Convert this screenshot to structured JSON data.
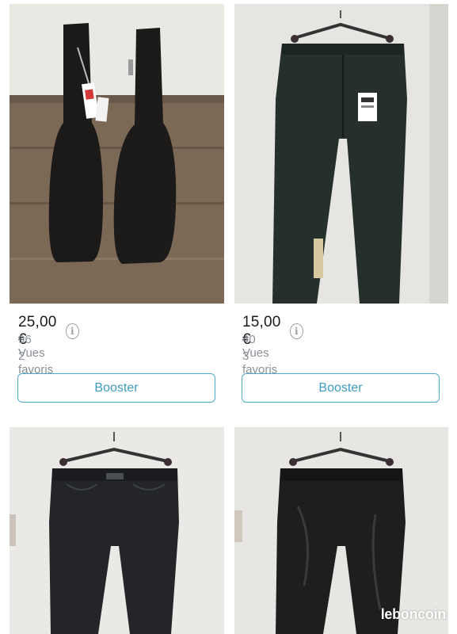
{
  "listings": [
    {
      "price": "25,00 €",
      "views": "96 Vues",
      "favorites": "2 favoris",
      "booster_label": "Booster"
    },
    {
      "price": "15,00 €",
      "views": "40 Vues",
      "favorites": "3 favoris",
      "booster_label": "Booster"
    }
  ],
  "watermark": "leboncoin",
  "colors": {
    "accent": "#4fa9c8",
    "price_text": "#1a1a1a",
    "meta_text": "#8a8f96"
  },
  "icons": {
    "info": "info-circle-icon"
  }
}
